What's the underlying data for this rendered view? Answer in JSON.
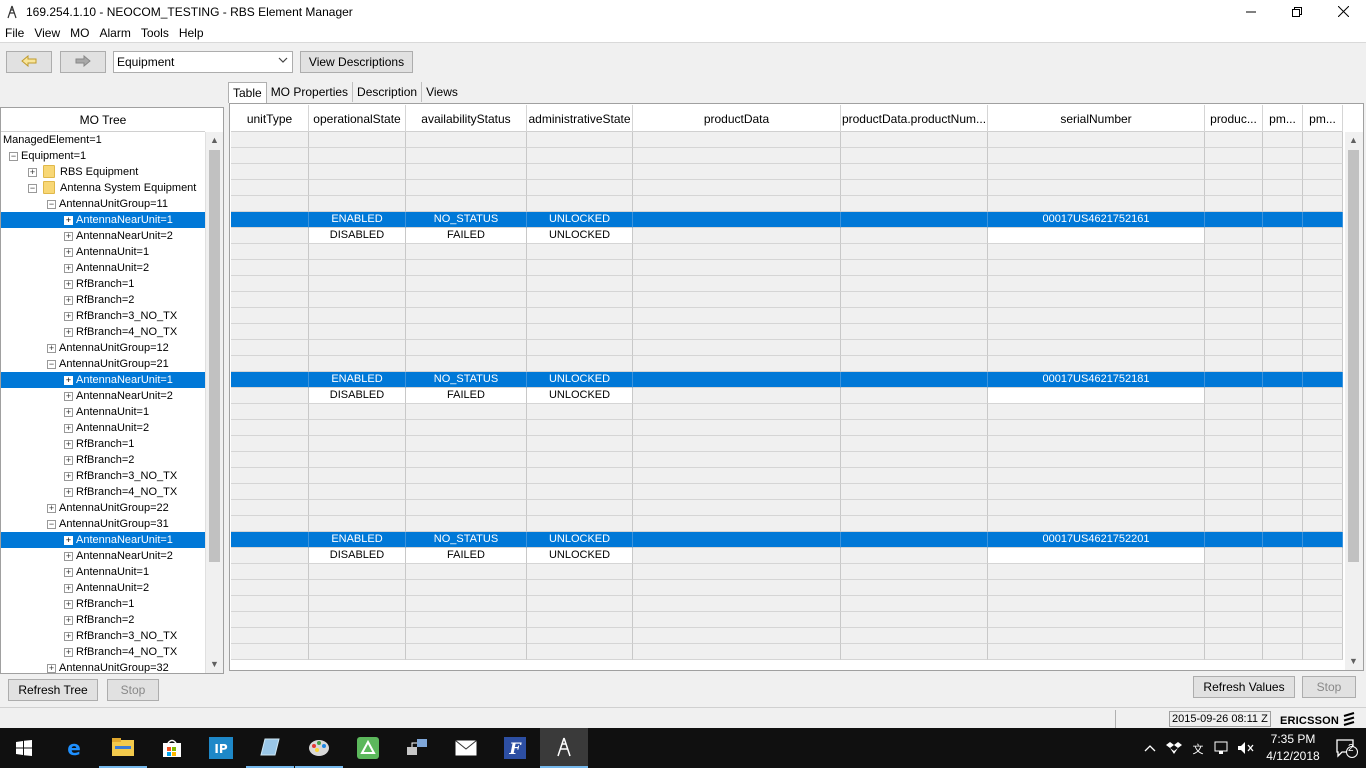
{
  "window": {
    "title": "169.254.1.10 - NEOCOM_TESTING - RBS Element Manager",
    "minimize": "—",
    "restore": "❐",
    "close": "✕"
  },
  "menu": [
    "File",
    "View",
    "MO",
    "Alarm",
    "Tools",
    "Help"
  ],
  "toolbar": {
    "back_icon": "arrow-left-icon",
    "forward_icon": "arrow-right-icon",
    "view_select_value": "Equipment",
    "view_descriptions_label": "View Descriptions"
  },
  "tree": {
    "header": "MO Tree",
    "rows": [
      {
        "label": "ManagedElement=1",
        "level": 0,
        "exp": "",
        "folder": false,
        "selected": false
      },
      {
        "label": "Equipment=1",
        "level": 1,
        "exp": "−",
        "folder": false,
        "selected": false
      },
      {
        "label": "RBS Equipment",
        "level": 2,
        "exp": "+",
        "folder": true,
        "selected": false
      },
      {
        "label": "Antenna System Equipment",
        "level": 2,
        "exp": "−",
        "folder": true,
        "selected": false
      },
      {
        "label": "AntennaUnitGroup=11",
        "level": 3,
        "exp": "−",
        "folder": false,
        "selected": false
      },
      {
        "label": "AntennaNearUnit=1",
        "level": 4,
        "exp": "+",
        "folder": false,
        "selected": true
      },
      {
        "label": "AntennaNearUnit=2",
        "level": 4,
        "exp": "+",
        "folder": false,
        "selected": false
      },
      {
        "label": "AntennaUnit=1",
        "level": 4,
        "exp": "+",
        "folder": false,
        "selected": false
      },
      {
        "label": "AntennaUnit=2",
        "level": 4,
        "exp": "+",
        "folder": false,
        "selected": false
      },
      {
        "label": "RfBranch=1",
        "level": 4,
        "exp": "+",
        "folder": false,
        "selected": false
      },
      {
        "label": "RfBranch=2",
        "level": 4,
        "exp": "+",
        "folder": false,
        "selected": false
      },
      {
        "label": "RfBranch=3_NO_TX",
        "level": 4,
        "exp": "+",
        "folder": false,
        "selected": false
      },
      {
        "label": "RfBranch=4_NO_TX",
        "level": 4,
        "exp": "+",
        "folder": false,
        "selected": false
      },
      {
        "label": "AntennaUnitGroup=12",
        "level": 3,
        "exp": "+",
        "folder": false,
        "selected": false
      },
      {
        "label": "AntennaUnitGroup=21",
        "level": 3,
        "exp": "−",
        "folder": false,
        "selected": false
      },
      {
        "label": "AntennaNearUnit=1",
        "level": 4,
        "exp": "+",
        "folder": false,
        "selected": true
      },
      {
        "label": "AntennaNearUnit=2",
        "level": 4,
        "exp": "+",
        "folder": false,
        "selected": false
      },
      {
        "label": "AntennaUnit=1",
        "level": 4,
        "exp": "+",
        "folder": false,
        "selected": false
      },
      {
        "label": "AntennaUnit=2",
        "level": 4,
        "exp": "+",
        "folder": false,
        "selected": false
      },
      {
        "label": "RfBranch=1",
        "level": 4,
        "exp": "+",
        "folder": false,
        "selected": false
      },
      {
        "label": "RfBranch=2",
        "level": 4,
        "exp": "+",
        "folder": false,
        "selected": false
      },
      {
        "label": "RfBranch=3_NO_TX",
        "level": 4,
        "exp": "+",
        "folder": false,
        "selected": false
      },
      {
        "label": "RfBranch=4_NO_TX",
        "level": 4,
        "exp": "+",
        "folder": false,
        "selected": false
      },
      {
        "label": "AntennaUnitGroup=22",
        "level": 3,
        "exp": "+",
        "folder": false,
        "selected": false
      },
      {
        "label": "AntennaUnitGroup=31",
        "level": 3,
        "exp": "−",
        "folder": false,
        "selected": false
      },
      {
        "label": "AntennaNearUnit=1",
        "level": 4,
        "exp": "+",
        "folder": false,
        "selected": true
      },
      {
        "label": "AntennaNearUnit=2",
        "level": 4,
        "exp": "+",
        "folder": false,
        "selected": false
      },
      {
        "label": "AntennaUnit=1",
        "level": 4,
        "exp": "+",
        "folder": false,
        "selected": false
      },
      {
        "label": "AntennaUnit=2",
        "level": 4,
        "exp": "+",
        "folder": false,
        "selected": false
      },
      {
        "label": "RfBranch=1",
        "level": 4,
        "exp": "+",
        "folder": false,
        "selected": false
      },
      {
        "label": "RfBranch=2",
        "level": 4,
        "exp": "+",
        "folder": false,
        "selected": false
      },
      {
        "label": "RfBranch=3_NO_TX",
        "level": 4,
        "exp": "+",
        "folder": false,
        "selected": false
      },
      {
        "label": "RfBranch=4_NO_TX",
        "level": 4,
        "exp": "+",
        "folder": false,
        "selected": false
      },
      {
        "label": "AntennaUnitGroup=32",
        "level": 3,
        "exp": "+",
        "folder": false,
        "selected": false
      }
    ]
  },
  "buttons": {
    "refresh_tree": "Refresh Tree",
    "stop_tree": "Stop",
    "refresh_values": "Refresh Values",
    "stop_values": "Stop"
  },
  "tabs": [
    {
      "label": "Table",
      "active": true
    },
    {
      "label": "MO Properties",
      "active": false
    },
    {
      "label": "Description",
      "active": false
    },
    {
      "label": "Views",
      "active": false
    }
  ],
  "table": {
    "columns": [
      "unitType",
      "operationalState",
      "availabilityStatus",
      "administrativeState",
      "productData",
      "productData.productNum...",
      "serialNumber",
      "produc...",
      "pm...",
      "pm..."
    ],
    "rows": [
      {
        "style": "empty",
        "cells": [
          "",
          "",
          "",
          "",
          "",
          "",
          "",
          "",
          "",
          ""
        ]
      },
      {
        "style": "empty",
        "cells": [
          "",
          "",
          "",
          "",
          "",
          "",
          "",
          "",
          "",
          ""
        ]
      },
      {
        "style": "empty",
        "cells": [
          "",
          "",
          "",
          "",
          "",
          "",
          "",
          "",
          "",
          ""
        ]
      },
      {
        "style": "empty",
        "cells": [
          "",
          "",
          "",
          "",
          "",
          "",
          "",
          "",
          "",
          ""
        ]
      },
      {
        "style": "empty",
        "cells": [
          "",
          "",
          "",
          "",
          "",
          "",
          "",
          "",
          "",
          ""
        ]
      },
      {
        "style": "selected",
        "cells": [
          "",
          "ENABLED",
          "NO_STATUS",
          "UNLOCKED",
          "",
          "",
          "00017US4621752161",
          "",
          "",
          ""
        ]
      },
      {
        "style": "white",
        "cells": [
          "",
          "DISABLED",
          "FAILED",
          "UNLOCKED",
          "",
          "",
          "",
          "",
          "",
          ""
        ]
      },
      {
        "style": "empty",
        "cells": [
          "",
          "",
          "",
          "",
          "",
          "",
          "",
          "",
          "",
          ""
        ]
      },
      {
        "style": "empty",
        "cells": [
          "",
          "",
          "",
          "",
          "",
          "",
          "",
          "",
          "",
          ""
        ]
      },
      {
        "style": "empty",
        "cells": [
          "",
          "",
          "",
          "",
          "",
          "",
          "",
          "",
          "",
          ""
        ]
      },
      {
        "style": "empty",
        "cells": [
          "",
          "",
          "",
          "",
          "",
          "",
          "",
          "",
          "",
          ""
        ]
      },
      {
        "style": "empty",
        "cells": [
          "",
          "",
          "",
          "",
          "",
          "",
          "",
          "",
          "",
          ""
        ]
      },
      {
        "style": "empty",
        "cells": [
          "",
          "",
          "",
          "",
          "",
          "",
          "",
          "",
          "",
          ""
        ]
      },
      {
        "style": "empty",
        "cells": [
          "",
          "",
          "",
          "",
          "",
          "",
          "",
          "",
          "",
          ""
        ]
      },
      {
        "style": "empty",
        "cells": [
          "",
          "",
          "",
          "",
          "",
          "",
          "",
          "",
          "",
          ""
        ]
      },
      {
        "style": "selected",
        "cells": [
          "",
          "ENABLED",
          "NO_STATUS",
          "UNLOCKED",
          "",
          "",
          "00017US4621752181",
          "",
          "",
          ""
        ]
      },
      {
        "style": "white",
        "cells": [
          "",
          "DISABLED",
          "FAILED",
          "UNLOCKED",
          "",
          "",
          "",
          "",
          "",
          ""
        ]
      },
      {
        "style": "empty",
        "cells": [
          "",
          "",
          "",
          "",
          "",
          "",
          "",
          "",
          "",
          ""
        ]
      },
      {
        "style": "empty",
        "cells": [
          "",
          "",
          "",
          "",
          "",
          "",
          "",
          "",
          "",
          ""
        ]
      },
      {
        "style": "empty",
        "cells": [
          "",
          "",
          "",
          "",
          "",
          "",
          "",
          "",
          "",
          ""
        ]
      },
      {
        "style": "empty",
        "cells": [
          "",
          "",
          "",
          "",
          "",
          "",
          "",
          "",
          "",
          ""
        ]
      },
      {
        "style": "empty",
        "cells": [
          "",
          "",
          "",
          "",
          "",
          "",
          "",
          "",
          "",
          ""
        ]
      },
      {
        "style": "empty",
        "cells": [
          "",
          "",
          "",
          "",
          "",
          "",
          "",
          "",
          "",
          ""
        ]
      },
      {
        "style": "empty",
        "cells": [
          "",
          "",
          "",
          "",
          "",
          "",
          "",
          "",
          "",
          ""
        ]
      },
      {
        "style": "empty",
        "cells": [
          "",
          "",
          "",
          "",
          "",
          "",
          "",
          "",
          "",
          ""
        ]
      },
      {
        "style": "selected",
        "cells": [
          "",
          "ENABLED",
          "NO_STATUS",
          "UNLOCKED",
          "",
          "",
          "00017US4621752201",
          "",
          "",
          ""
        ]
      },
      {
        "style": "white",
        "cells": [
          "",
          "DISABLED",
          "FAILED",
          "UNLOCKED",
          "",
          "",
          "",
          "",
          "",
          ""
        ]
      },
      {
        "style": "empty",
        "cells": [
          "",
          "",
          "",
          "",
          "",
          "",
          "",
          "",
          "",
          ""
        ]
      },
      {
        "style": "empty",
        "cells": [
          "",
          "",
          "",
          "",
          "",
          "",
          "",
          "",
          "",
          ""
        ]
      },
      {
        "style": "empty",
        "cells": [
          "",
          "",
          "",
          "",
          "",
          "",
          "",
          "",
          "",
          ""
        ]
      },
      {
        "style": "empty",
        "cells": [
          "",
          "",
          "",
          "",
          "",
          "",
          "",
          "",
          "",
          ""
        ]
      },
      {
        "style": "empty",
        "cells": [
          "",
          "",
          "",
          "",
          "",
          "",
          "",
          "",
          "",
          ""
        ]
      },
      {
        "style": "empty",
        "cells": [
          "",
          "",
          "",
          "",
          "",
          "",
          "",
          "",
          "",
          ""
        ]
      }
    ]
  },
  "status": {
    "timestamp": "2015-09-26 08:11 Z",
    "brand": "ERICSSON"
  },
  "taskbar": {
    "apps": [
      "windows-start-icon",
      "edge-icon",
      "file-explorer-icon",
      "store-icon",
      "app-ip-icon",
      "app-notepad-icon",
      "paint-icon",
      "app-green-icon",
      "network-app-icon",
      "mail-icon",
      "app-f-icon",
      "rbs-element-manager-icon"
    ],
    "clock_time": "7:35 PM",
    "clock_date": "4/12/2018",
    "notification_count": "2"
  },
  "colors": {
    "selection": "#0078d7",
    "taskbar": "#101010",
    "accent_underline": "#76b9ed"
  }
}
